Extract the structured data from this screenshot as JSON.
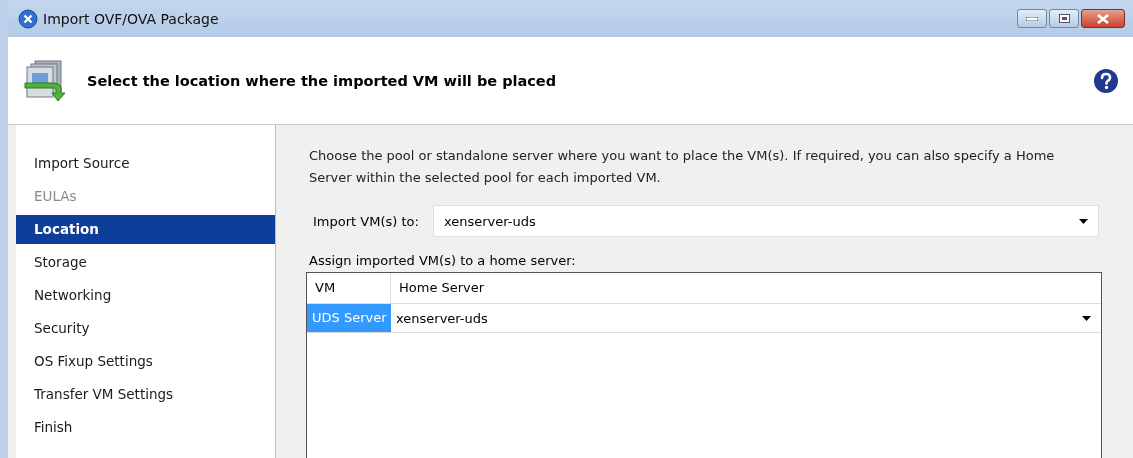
{
  "window": {
    "title": "Import OVF/OVA Package"
  },
  "header": {
    "title": "Select the location where the imported VM will be placed"
  },
  "steps": [
    {
      "label": "Import Source",
      "selected": false,
      "disabled": false
    },
    {
      "label": "EULAs",
      "selected": false,
      "disabled": true
    },
    {
      "label": "Location",
      "selected": true,
      "disabled": false
    },
    {
      "label": "Storage",
      "selected": false,
      "disabled": false
    },
    {
      "label": "Networking",
      "selected": false,
      "disabled": false
    },
    {
      "label": "Security",
      "selected": false,
      "disabled": false
    },
    {
      "label": "OS Fixup Settings",
      "selected": false,
      "disabled": false
    },
    {
      "label": "Transfer VM Settings",
      "selected": false,
      "disabled": false
    },
    {
      "label": "Finish",
      "selected": false,
      "disabled": false
    }
  ],
  "page": {
    "description": "Choose the pool or standalone server where you want to place the VM(s). If required, you can also specify a Home Server within the selected pool for each imported VM.",
    "import_to": {
      "label": "Import VM(s) to:",
      "value": "xenserver-uds"
    },
    "assign_label": "Assign imported VM(s) to a home server:",
    "table": {
      "columns": [
        "VM",
        "Home Server"
      ],
      "rows": [
        {
          "vm": "UDS Server",
          "home_server": "xenserver-uds",
          "selected": true
        }
      ]
    }
  }
}
